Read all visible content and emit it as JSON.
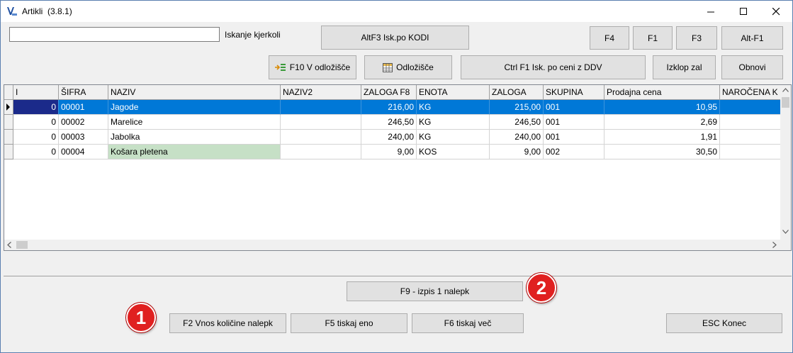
{
  "window": {
    "title": "Artikli",
    "version": "(3.8.1)",
    "minimize_icon": "minimize-icon",
    "maximize_icon": "maximize-icon",
    "close_icon": "close-icon"
  },
  "search": {
    "value": "",
    "label": "Iskanje kjerkoli"
  },
  "toolbar": {
    "altf3": "AltF3 Isk.po KODI",
    "f4": "F4",
    "f1": "F1",
    "f3": "F3",
    "altf1": "Alt-F1",
    "f10": "F10 V odložišče",
    "odlozisce": "Odložišče",
    "ctrlf1": "Ctrl F1 Isk. po ceni z DDV",
    "izklop": "Izklop zal",
    "obnovi": "Obnovi"
  },
  "grid": {
    "columns": [
      "I",
      "ŠIFRA",
      "NAZIV",
      "NAZIV2",
      "ZALOGA F8",
      "ENOTA",
      "ZALOGA",
      "SKUPINA",
      "Prodajna cena",
      "NAROČENA K"
    ],
    "rows": [
      {
        "i": "0",
        "sifra": "00001",
        "naziv": "Jagode",
        "naziv2": "",
        "zaloga_f8": "216,00",
        "enota": "KG",
        "zaloga": "215,00",
        "skupina": "001",
        "cena": "10,95",
        "narocena": ""
      },
      {
        "i": "0",
        "sifra": "00002",
        "naziv": "Marelice",
        "naziv2": "",
        "zaloga_f8": "246,50",
        "enota": "KG",
        "zaloga": "246,50",
        "skupina": "001",
        "cena": "2,69",
        "narocena": ""
      },
      {
        "i": "0",
        "sifra": "00003",
        "naziv": "Jabolka",
        "naziv2": "",
        "zaloga_f8": "240,00",
        "enota": "KG",
        "zaloga": "240,00",
        "skupina": "001",
        "cena": "1,91",
        "narocena": ""
      },
      {
        "i": "0",
        "sifra": "00004",
        "naziv": "Košara pletena",
        "naziv2": "",
        "zaloga_f8": "9,00",
        "enota": "KOS",
        "zaloga": "9,00",
        "skupina": "002",
        "cena": "30,50",
        "narocena": ""
      }
    ],
    "selected_row": 0,
    "highlight_color": "#0078d7",
    "green_cell_color": "#c6e0c6"
  },
  "actions": {
    "f9": "F9 - izpis 1 nalepk",
    "f2": "F2 Vnos količine nalepk",
    "f5": "F5 tiskaj eno",
    "f6": "F6 tiskaj več",
    "esc": "ESC Konec"
  },
  "badges": {
    "one": "1",
    "two": "2",
    "color": "#e02020"
  }
}
